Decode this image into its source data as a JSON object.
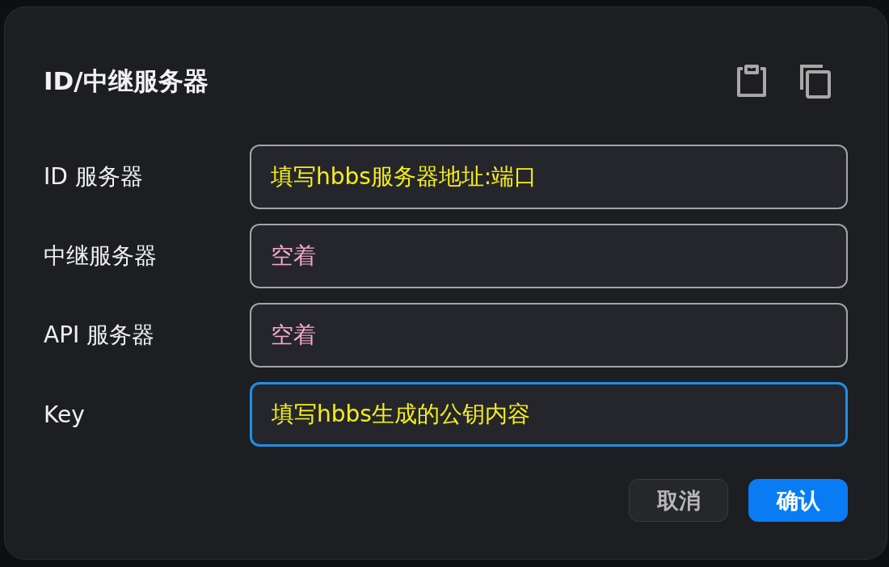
{
  "dialog": {
    "title": "ID/中继服务器"
  },
  "fields": [
    {
      "label": "ID 服务器",
      "value": "填写hbbs服务器地址:端口",
      "color": "#f5ee1c",
      "focused": false
    },
    {
      "label": "中继服务器",
      "value": "空着",
      "color": "#f3a9c9",
      "focused": false
    },
    {
      "label": "API 服务器",
      "value": "空着",
      "color": "#f3a9c9",
      "focused": false
    },
    {
      "label": "Key",
      "value": "填写hbbs生成的公钥内容",
      "color": "#f5ee1c",
      "focused": true
    }
  ],
  "buttons": [
    {
      "label": "取消",
      "kind": "secondary"
    },
    {
      "label": "确认",
      "kind": "primary"
    }
  ]
}
